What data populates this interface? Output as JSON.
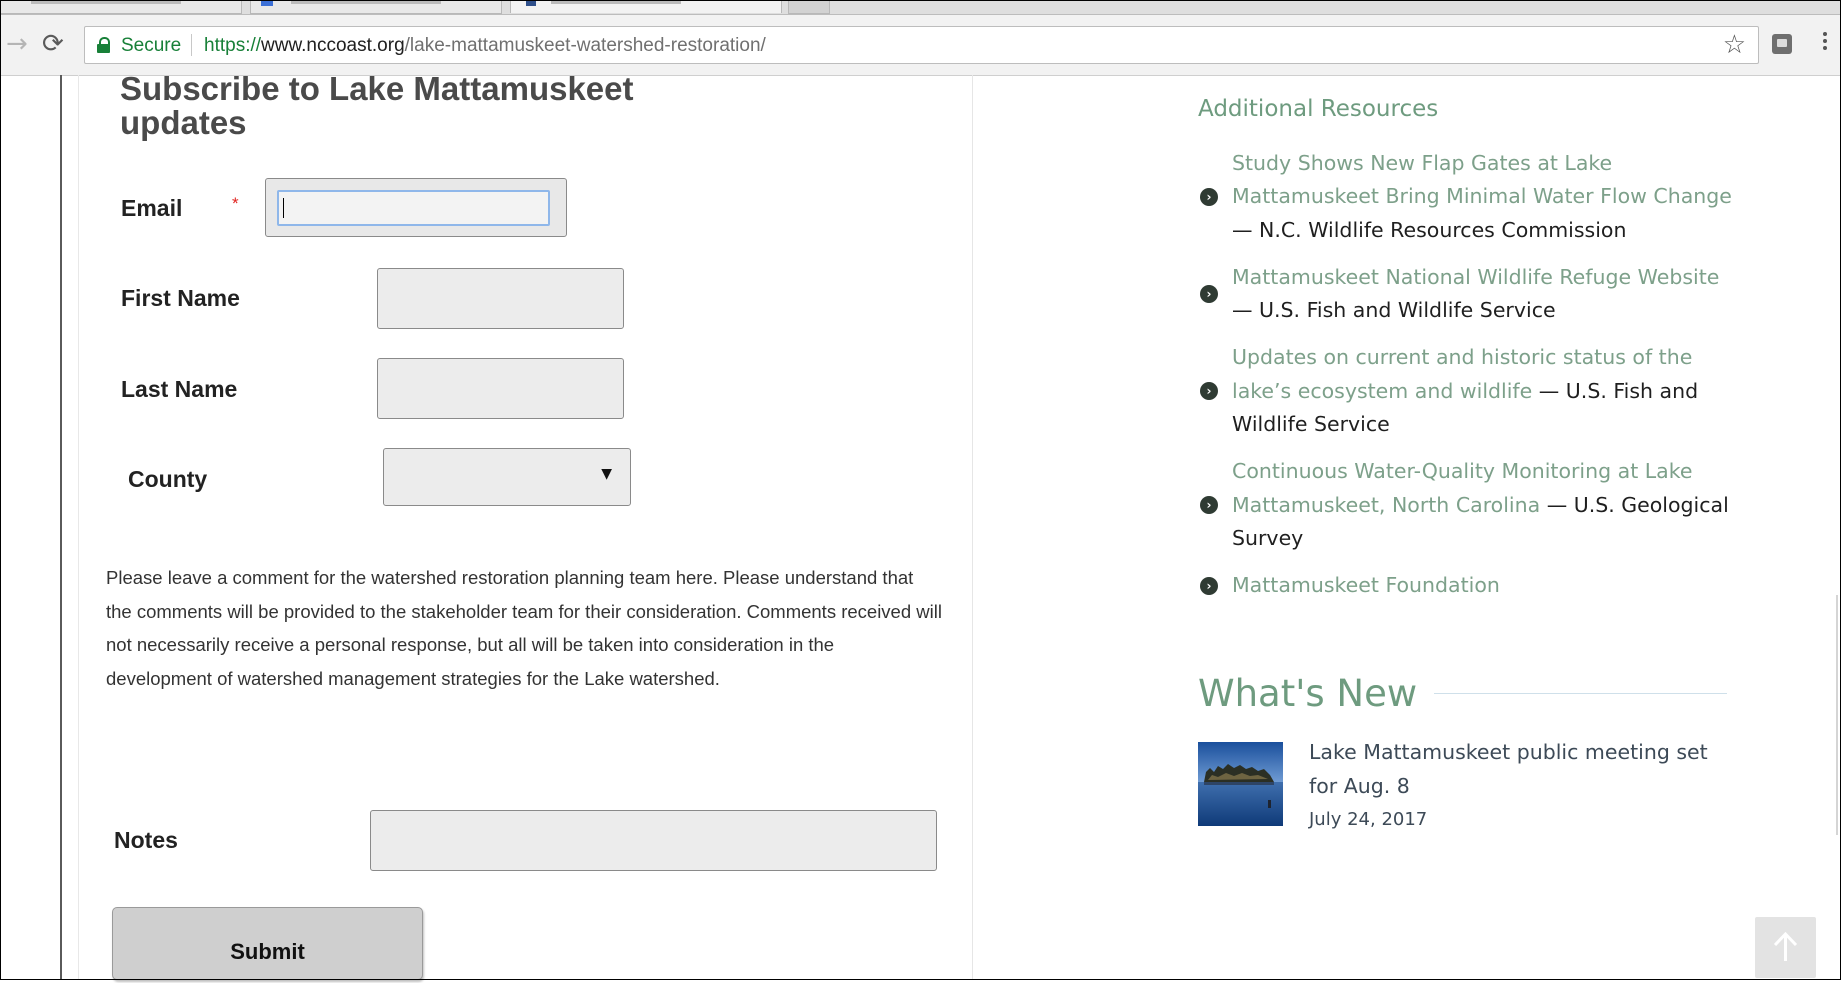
{
  "browser": {
    "security_label": "Secure",
    "url_scheme": "https://",
    "url_host": "www.nccoast.org",
    "url_path": "/lake-mattamuskeet-watershed-restoration/"
  },
  "form": {
    "title": "Subscribe to Lake Mattamuskeet updates",
    "email_label": "Email",
    "required_marker": "*",
    "first_name_label": "First Name",
    "last_name_label": "Last Name",
    "county_label": "County",
    "county_selected": "",
    "comment_text": "Please leave a comment for the watershed restoration planning team here. Please understand that the comments will be provided to the stakeholder team for their consideration. Comments received will not necessarily receive a personal response, but all will be taken into consideration in the development of watershed management strategies for the Lake watershed.",
    "notes_label": "Notes",
    "submit_label": "Submit"
  },
  "resources": {
    "heading": "Additional Resources",
    "items": [
      {
        "link": "Study Shows New Flap Gates at Lake Mattamuskeet Bring Minimal Water Flow Change",
        "source": " — N.C. Wildlife Resources Commission"
      },
      {
        "link": "Mattamuskeet National Wildlife Refuge Website",
        "source": " — U.S. Fish and Wildlife Service"
      },
      {
        "link": "Updates on current and historic status of the lake’s ecosystem and wildlife",
        "source": " — U.S. Fish and Wildlife Service"
      },
      {
        "link": "Continuous Water-Quality Monitoring at Lake Mattamuskeet, North Carolina",
        "source": " — U.S. Geological Survey"
      },
      {
        "link": "Mattamuskeet Foundation",
        "source": ""
      }
    ]
  },
  "whats_new": {
    "heading": "What's New",
    "items": [
      {
        "title": "Lake Mattamuskeet public meeting set for Aug. 8",
        "date": "July 24, 2017"
      }
    ]
  },
  "colors": {
    "accent_green": "#6e9b7f",
    "link_green": "#7da08a",
    "secure_green": "#188038",
    "required_red": "#e0231f"
  },
  "icons": [
    "back-arrow-icon",
    "reload-icon",
    "lock-icon",
    "star-icon",
    "extension-icon",
    "menu-icon",
    "chevron-right-icon",
    "arrow-up-icon"
  ]
}
